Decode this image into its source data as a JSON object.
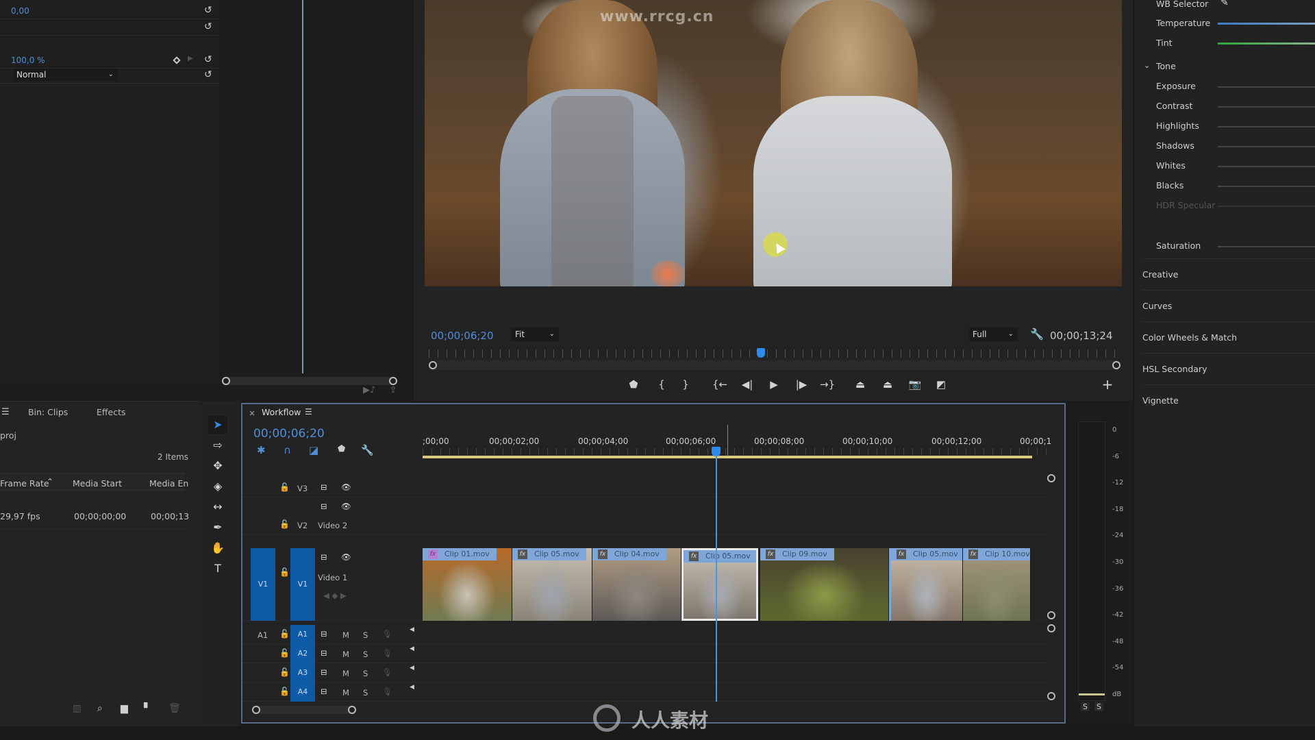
{
  "effect_controls": {
    "value_1": "0,00",
    "opacity_value": "100,0 %",
    "blend_mode": "Normal"
  },
  "program_monitor": {
    "watermark_url": "www.rrcg.cn",
    "current_timecode": "00;00;06;20",
    "zoom_select": "Fit",
    "resolution_select": "Full",
    "duration_timecode": "00;00;13;24",
    "playhead_fraction": 0.48,
    "transport": [
      {
        "name": "add-marker-button",
        "glyph": "⬟"
      },
      {
        "name": "mark-in-button",
        "glyph": "{"
      },
      {
        "name": "mark-out-button",
        "glyph": "}"
      },
      {
        "name": "go-to-in-button",
        "glyph": "{←"
      },
      {
        "name": "step-back-button",
        "glyph": "◀|"
      },
      {
        "name": "play-button",
        "glyph": "▶"
      },
      {
        "name": "step-forward-button",
        "glyph": "|▶"
      },
      {
        "name": "go-to-out-button",
        "glyph": "→}"
      },
      {
        "name": "lift-button",
        "glyph": "⏏"
      },
      {
        "name": "extract-button",
        "glyph": "⏏"
      },
      {
        "name": "export-frame-button",
        "glyph": "📷"
      },
      {
        "name": "compare-view-button",
        "glyph": "◩"
      }
    ]
  },
  "lumetri": {
    "wb_selector": "WB Selector",
    "temperature": "Temperature",
    "tint": "Tint",
    "tone_header": "Tone",
    "tone_sliders": [
      "Exposure",
      "Contrast",
      "Highlights",
      "Shadows",
      "Whites",
      "Blacks",
      "HDR Specular"
    ],
    "saturation": "Saturation",
    "sections": [
      "Creative",
      "Curves",
      "Color Wheels & Match",
      "HSL Secondary",
      "Vignette"
    ]
  },
  "project": {
    "tabs": [
      "Bin: Clips",
      "Effects"
    ],
    "path": "proj",
    "items_count": "2 Items",
    "columns": [
      "Frame Rate",
      "Media Start",
      "Media En"
    ],
    "rows": [
      {
        "frame_rate": "29,97 fps",
        "media_start": "00;00;00;00",
        "media_end": "00;00;13"
      }
    ]
  },
  "timeline": {
    "sequence_name": "Workflow",
    "timecode": "00;00;06;20",
    "ruler_labels": [
      ";00;00",
      "00;00;02;00",
      "00;00;04;00",
      "00;00;06;00",
      "00;00;08;00",
      "00;00;10;00",
      "00;00;12;00",
      "00;00;1"
    ],
    "video_tracks": [
      {
        "id": "V3",
        "name": ""
      },
      {
        "id": "V2",
        "name": "Video 2"
      },
      {
        "id": "V1",
        "name": "Video 1",
        "source": "V1"
      }
    ],
    "audio_tracks": [
      {
        "id": "A1",
        "source": "A1"
      },
      {
        "id": "A2"
      },
      {
        "id": "A3"
      },
      {
        "id": "A4"
      }
    ],
    "mute_label": "M",
    "solo_label": "S",
    "clips": [
      {
        "name": "Clip 01.mov",
        "colors": [
          "#6e7a52",
          "#c9c2b6",
          "#b86a2a"
        ]
      },
      {
        "name": "Clip 05.mov",
        "colors": [
          "#8a8478",
          "#9ea4ad",
          "#c6bfb0"
        ]
      },
      {
        "name": "Clip 04.mov",
        "colors": [
          "#5c5a58",
          "#8d8780",
          "#b29c82"
        ]
      },
      {
        "name": "Clip 05.mov",
        "colors": [
          "#7d776d",
          "#a7acb2",
          "#c9c1b2"
        ]
      },
      {
        "name": "Clip 09.mov",
        "colors": [
          "#5d6a2e",
          "#8e9a48",
          "#4a4230"
        ]
      },
      {
        "name": "Clip 05.mov",
        "colors": [
          "#85766a",
          "#aeb3ba",
          "#c8bca9"
        ]
      },
      {
        "name": "Clip 10.mov",
        "colors": [
          "#6f7456",
          "#8b8e6e",
          "#a79880"
        ]
      }
    ]
  },
  "audio_meter": {
    "scale": [
      "0",
      "-6",
      "-12",
      "-18",
      "-24",
      "-30",
      "-36",
      "-42",
      "-48",
      "-54",
      "dB"
    ],
    "solo_buttons": [
      "S",
      "S"
    ]
  },
  "watermark": {
    "logo_text": "人人素材"
  }
}
